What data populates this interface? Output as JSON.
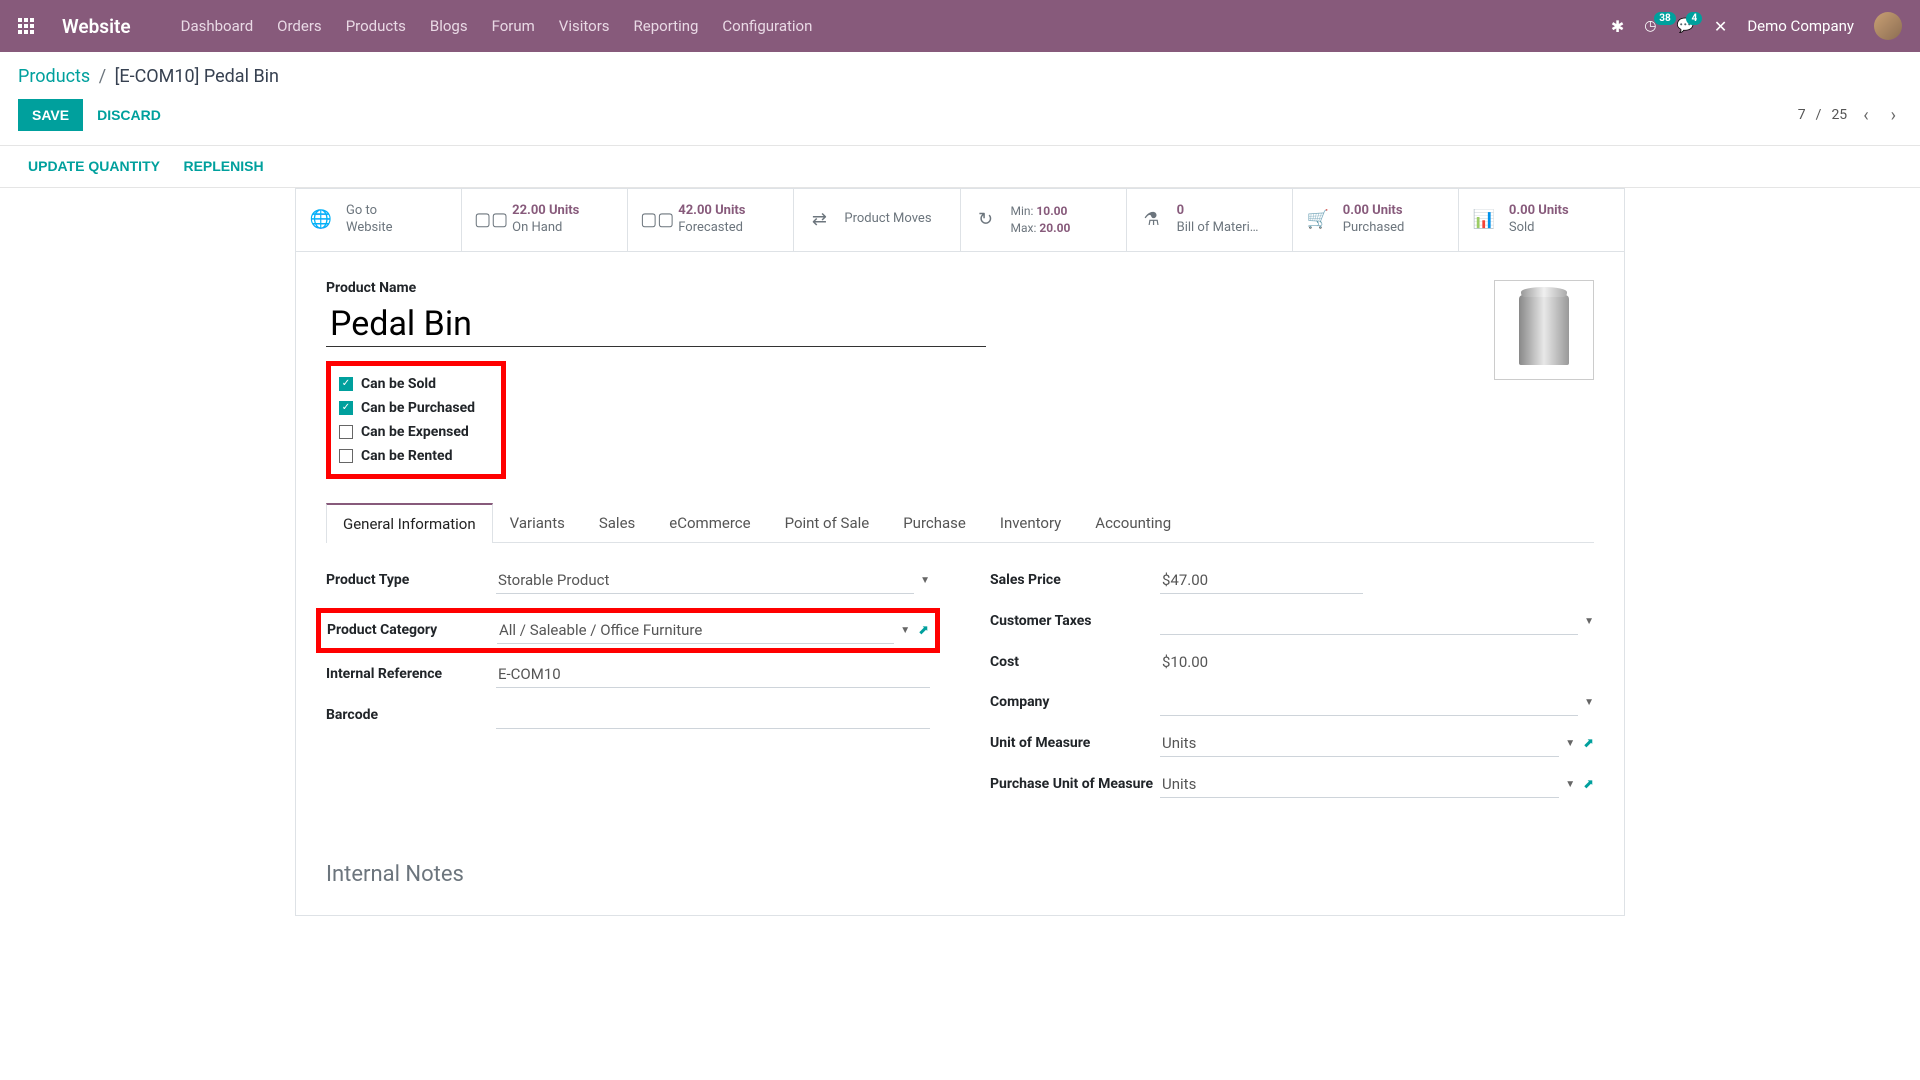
{
  "nav": {
    "brand": "Website",
    "links": [
      "Dashboard",
      "Orders",
      "Products",
      "Blogs",
      "Forum",
      "Visitors",
      "Reporting",
      "Configuration"
    ],
    "badge1": "38",
    "badge2": "4",
    "company": "Demo Company"
  },
  "breadcrumb": {
    "root": "Products",
    "current": "[E-COM10] Pedal Bin"
  },
  "buttons": {
    "save": "SAVE",
    "discard": "DISCARD",
    "update_qty": "UPDATE QUANTITY",
    "replenish": "REPLENISH"
  },
  "pager": {
    "cur": "7",
    "total": "25",
    "sep": "/"
  },
  "stats": {
    "goto1": "Go to",
    "goto2": "Website",
    "onhand_v": "22.00 Units",
    "onhand_l": "On Hand",
    "fore_v": "42.00 Units",
    "fore_l": "Forecasted",
    "moves": "Product Moves",
    "min_l": "Min:",
    "min_v": "10.00",
    "max_l": "Max:",
    "max_v": "20.00",
    "bom_v": "0",
    "bom_l": "Bill of Materi…",
    "pur_v": "0.00 Units",
    "pur_l": "Purchased",
    "sold_v": "0.00 Units",
    "sold_l": "Sold"
  },
  "product": {
    "name_lbl": "Product Name",
    "name": "Pedal Bin"
  },
  "checks": {
    "sold": "Can be Sold",
    "purchased": "Can be Purchased",
    "expensed": "Can be Expensed",
    "rented": "Can be Rented"
  },
  "tabs": [
    "General Information",
    "Variants",
    "Sales",
    "eCommerce",
    "Point of Sale",
    "Purchase",
    "Inventory",
    "Accounting"
  ],
  "fields": {
    "ptype_l": "Product Type",
    "ptype_v": "Storable Product",
    "pcat_l": "Product Category",
    "pcat_v": "All / Saleable / Office Furniture",
    "iref_l": "Internal Reference",
    "iref_v": "E-COM10",
    "barcode_l": "Barcode",
    "barcode_v": "",
    "sprice_l": "Sales Price",
    "sprice_v": "$47.00",
    "ctax_l": "Customer Taxes",
    "ctax_v": "",
    "cost_l": "Cost",
    "cost_v": "$10.00",
    "comp_l": "Company",
    "comp_v": "",
    "uom_l": "Unit of Measure",
    "uom_v": "Units",
    "puom_l": "Purchase Unit of Measure",
    "puom_v": "Units"
  },
  "notes": "Internal Notes"
}
